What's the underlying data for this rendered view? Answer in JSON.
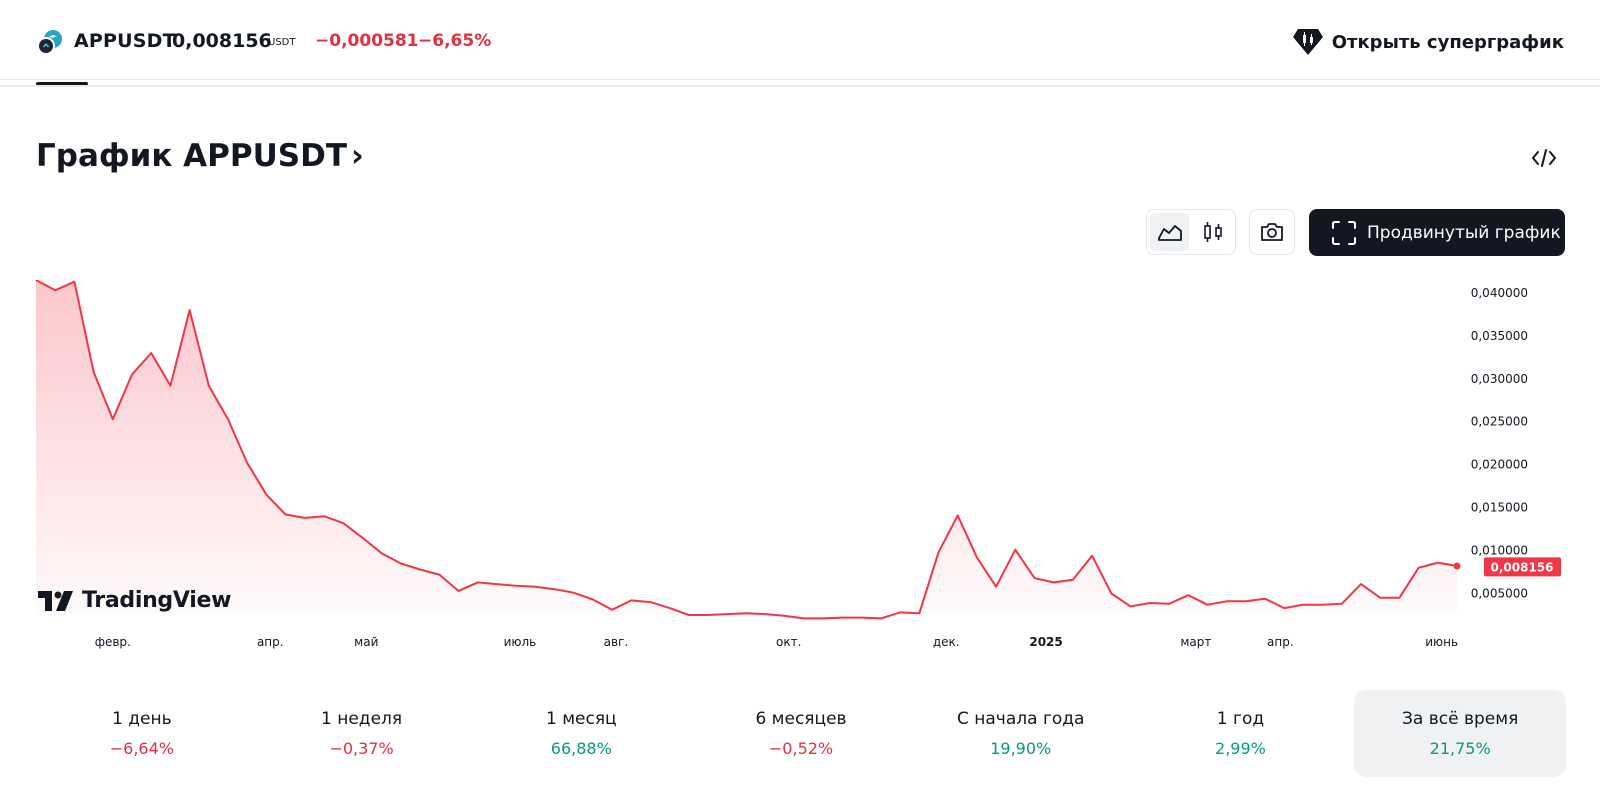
{
  "header": {
    "symbol": "APPUSDT",
    "price": "0,008156",
    "currency": "USDT",
    "change_abs": "−0,000581",
    "change_pct": "−6,65%",
    "open_super_label": "Открыть суперграфик",
    "icons": {
      "coin": "app-coin-logo",
      "super": "diamond-candles-icon"
    }
  },
  "title": {
    "text": "График APPUSDT",
    "chevron": "›"
  },
  "toolbar": {
    "chart_types": [
      {
        "name": "area-chart-icon",
        "active": true
      },
      {
        "name": "candles-chart-icon",
        "active": false
      }
    ],
    "snapshot_icon": "camera-icon",
    "advanced_label": "Продвинутый график",
    "embed_icon": "code-embed-icon"
  },
  "chart_data": {
    "type": "area",
    "ylim": [
      0.0025,
      0.0415
    ],
    "yticks": [
      "0,040000",
      "0,035000",
      "0,030000",
      "0,025000",
      "0,020000",
      "0,015000",
      "0,010000",
      "0,005000"
    ],
    "ytick_values": [
      0.04,
      0.035,
      0.03,
      0.025,
      0.02,
      0.015,
      0.01,
      0.005
    ],
    "x_labels": [
      {
        "label": "февр.",
        "t": 2.0
      },
      {
        "label": "апр.",
        "t": 6.1
      },
      {
        "label": "май",
        "t": 8.6
      },
      {
        "label": "июль",
        "t": 12.6
      },
      {
        "label": "авг.",
        "t": 15.1
      },
      {
        "label": "окт.",
        "t": 19.6
      },
      {
        "label": "дек.",
        "t": 23.7
      },
      {
        "label": "2025",
        "t": 26.3,
        "bold": true
      },
      {
        "label": "март",
        "t": 30.2
      },
      {
        "label": "апр.",
        "t": 32.4
      },
      {
        "label": "июнь",
        "t": 36.6
      }
    ],
    "series": [
      {
        "color": "#f23645",
        "points": [
          [
            0.0,
            0.042
          ],
          [
            0.5,
            0.0403
          ],
          [
            1.0,
            0.0413
          ],
          [
            1.5,
            0.0308
          ],
          [
            2.0,
            0.0253
          ],
          [
            2.5,
            0.0305
          ],
          [
            3.0,
            0.033
          ],
          [
            3.5,
            0.0292
          ],
          [
            4.0,
            0.038
          ],
          [
            4.5,
            0.0292
          ],
          [
            5.0,
            0.0253
          ],
          [
            5.5,
            0.0202
          ],
          [
            6.0,
            0.0165
          ],
          [
            6.5,
            0.0142
          ],
          [
            7.0,
            0.0138
          ],
          [
            7.5,
            0.014
          ],
          [
            8.0,
            0.0132
          ],
          [
            8.5,
            0.0115
          ],
          [
            9.0,
            0.0097
          ],
          [
            9.5,
            0.0085
          ],
          [
            10.0,
            0.0078
          ],
          [
            10.5,
            0.0072
          ],
          [
            11.0,
            0.0053
          ],
          [
            11.5,
            0.0063
          ],
          [
            12.0,
            0.0061
          ],
          [
            12.5,
            0.0059
          ],
          [
            13.0,
            0.0058
          ],
          [
            13.5,
            0.0055
          ],
          [
            14.0,
            0.0051
          ],
          [
            14.5,
            0.0043
          ],
          [
            15.0,
            0.0031
          ],
          [
            15.5,
            0.0042
          ],
          [
            16.0,
            0.004
          ],
          [
            16.5,
            0.0033
          ],
          [
            17.0,
            0.0025
          ],
          [
            17.5,
            0.0025
          ],
          [
            18.0,
            0.0026
          ],
          [
            18.5,
            0.0027
          ],
          [
            19.0,
            0.0026
          ],
          [
            19.5,
            0.0024
          ],
          [
            20.0,
            0.0021
          ],
          [
            20.5,
            0.0021
          ],
          [
            21.0,
            0.0022
          ],
          [
            21.5,
            0.0022
          ],
          [
            22.0,
            0.0021
          ],
          [
            22.5,
            0.0028
          ],
          [
            23.0,
            0.0027
          ],
          [
            23.5,
            0.0098
          ],
          [
            24.0,
            0.0141
          ],
          [
            24.5,
            0.0092
          ],
          [
            25.0,
            0.0058
          ],
          [
            25.5,
            0.0101
          ],
          [
            26.0,
            0.0068
          ],
          [
            26.5,
            0.0063
          ],
          [
            27.0,
            0.0066
          ],
          [
            27.5,
            0.0094
          ],
          [
            28.0,
            0.005
          ],
          [
            28.5,
            0.0035
          ],
          [
            29.0,
            0.0039
          ],
          [
            29.5,
            0.0038
          ],
          [
            30.0,
            0.0048
          ],
          [
            30.5,
            0.0037
          ],
          [
            31.0,
            0.0041
          ],
          [
            31.5,
            0.0041
          ],
          [
            32.0,
            0.0044
          ],
          [
            32.5,
            0.0033
          ],
          [
            33.0,
            0.0037
          ],
          [
            33.5,
            0.0037
          ],
          [
            34.0,
            0.0038
          ],
          [
            34.5,
            0.0061
          ],
          [
            35.0,
            0.0045
          ],
          [
            35.5,
            0.0045
          ],
          [
            36.0,
            0.008
          ],
          [
            36.5,
            0.0086
          ],
          [
            37.0,
            0.0082
          ]
        ],
        "last_value": 0.008156,
        "last_label": "0,008156"
      }
    ]
  },
  "watermark": {
    "text": "TradingView"
  },
  "periods": [
    {
      "label": "1 день",
      "value": "−6,64%",
      "sign": "neg"
    },
    {
      "label": "1 неделя",
      "value": "−0,37%",
      "sign": "neg"
    },
    {
      "label": "1 месяц",
      "value": "66,88%",
      "sign": "pos"
    },
    {
      "label": "6 месяцев",
      "value": "−0,52%",
      "sign": "neg"
    },
    {
      "label": "С начала года",
      "value": "19,90%",
      "sign": "pos"
    },
    {
      "label": "1 год",
      "value": "2,99%",
      "sign": "pos"
    },
    {
      "label": "За всё время",
      "value": "21,75%",
      "sign": "pos",
      "active": true
    }
  ]
}
